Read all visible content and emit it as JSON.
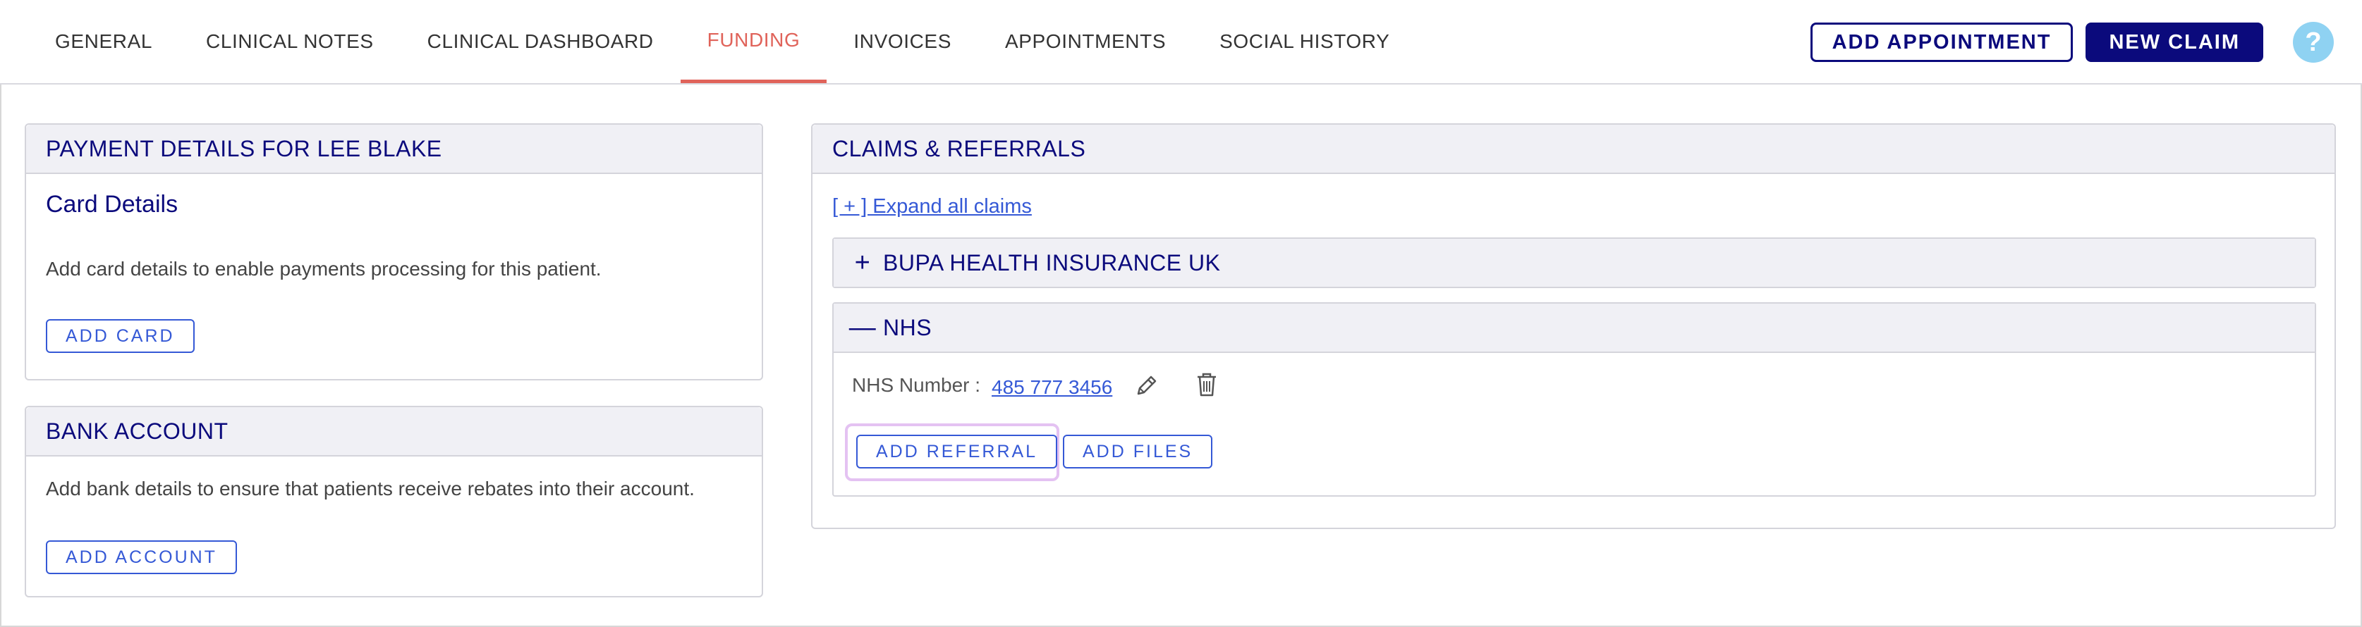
{
  "nav": {
    "tabs": [
      {
        "label": "GENERAL"
      },
      {
        "label": "CLINICAL NOTES"
      },
      {
        "label": "CLINICAL DASHBOARD"
      },
      {
        "label": "FUNDING"
      },
      {
        "label": "INVOICES"
      },
      {
        "label": "APPOINTMENTS"
      },
      {
        "label": "SOCIAL HISTORY"
      }
    ],
    "active_tab": "FUNDING",
    "add_appointment_label": "ADD APPOINTMENT",
    "new_claim_label": "NEW CLAIM",
    "help_symbol": "?"
  },
  "payment": {
    "title": "PAYMENT DETAILS FOR LEE BLAKE",
    "card_title": "Card Details",
    "card_text": "Add card details to enable payments processing for this patient.",
    "add_card_label": "ADD CARD"
  },
  "bank": {
    "title": "BANK ACCOUNT",
    "text": "Add bank details to ensure that patients receive rebates into their account.",
    "add_account_label": "ADD ACCOUNT"
  },
  "claims": {
    "title": "CLAIMS & REFERRALS",
    "expand_link": "[ + ] Expand all claims",
    "bupa": {
      "symbol": "+",
      "title": "BUPA HEALTH INSURANCE UK"
    },
    "nhs": {
      "symbol": "—",
      "title": "NHS",
      "number_label": "NHS Number :",
      "number_value": "485 777 3456",
      "add_referral_label": "ADD REFERRAL",
      "add_files_label": "ADD FILES"
    }
  },
  "colors": {
    "navy": "#0b0a7c",
    "active_tab": "#e0635a",
    "link_blue": "#3559d6",
    "help_bg": "#8fd2f2",
    "focus_ring": "#e4c2f2"
  }
}
